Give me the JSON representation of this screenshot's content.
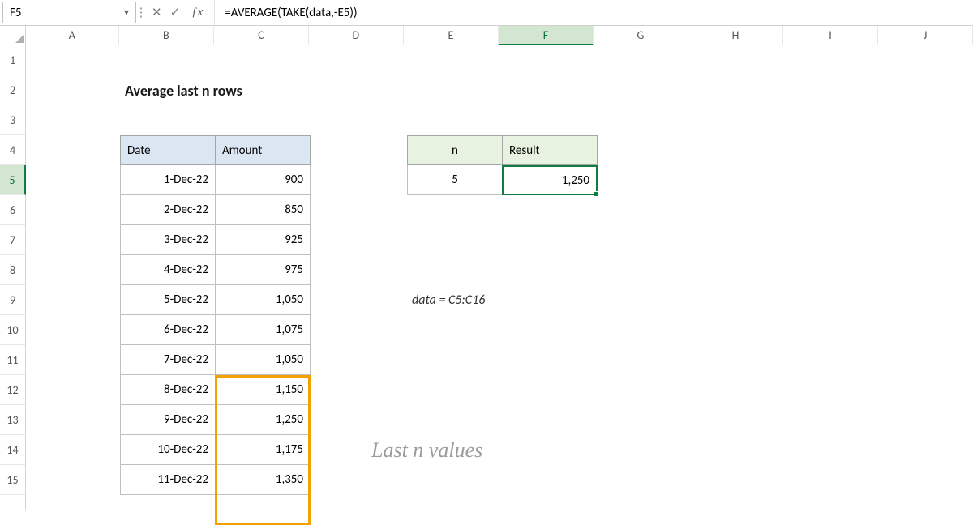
{
  "nameBox": "F5",
  "formula": "=AVERAGE(TAKE(data,-E5))",
  "columns": [
    "A",
    "B",
    "C",
    "D",
    "E",
    "F",
    "G",
    "H",
    "I",
    "J"
  ],
  "rows": [
    "1",
    "2",
    "3",
    "4",
    "5",
    "6",
    "7",
    "8",
    "9",
    "10",
    "11",
    "12",
    "13",
    "14",
    "15"
  ],
  "selectedCol": "F",
  "selectedRow": "5",
  "title": "Average last n rows",
  "dataTable": {
    "headers": {
      "date": "Date",
      "amount": "Amount"
    },
    "rows": [
      {
        "date": "1-Dec-22",
        "amount": "900"
      },
      {
        "date": "2-Dec-22",
        "amount": "850"
      },
      {
        "date": "3-Dec-22",
        "amount": "925"
      },
      {
        "date": "4-Dec-22",
        "amount": "975"
      },
      {
        "date": "5-Dec-22",
        "amount": "1,050"
      },
      {
        "date": "6-Dec-22",
        "amount": "1,075"
      },
      {
        "date": "7-Dec-22",
        "amount": "1,050"
      },
      {
        "date": "8-Dec-22",
        "amount": "1,150"
      },
      {
        "date": "9-Dec-22",
        "amount": "1,250"
      },
      {
        "date": "10-Dec-22",
        "amount": "1,175"
      },
      {
        "date": "11-Dec-22",
        "amount": "1,350"
      }
    ]
  },
  "resultTable": {
    "headers": {
      "n": "n",
      "result": "Result"
    },
    "n": "5",
    "result": "1,250"
  },
  "note1": "data = C5:C16",
  "note2": "Last n values"
}
